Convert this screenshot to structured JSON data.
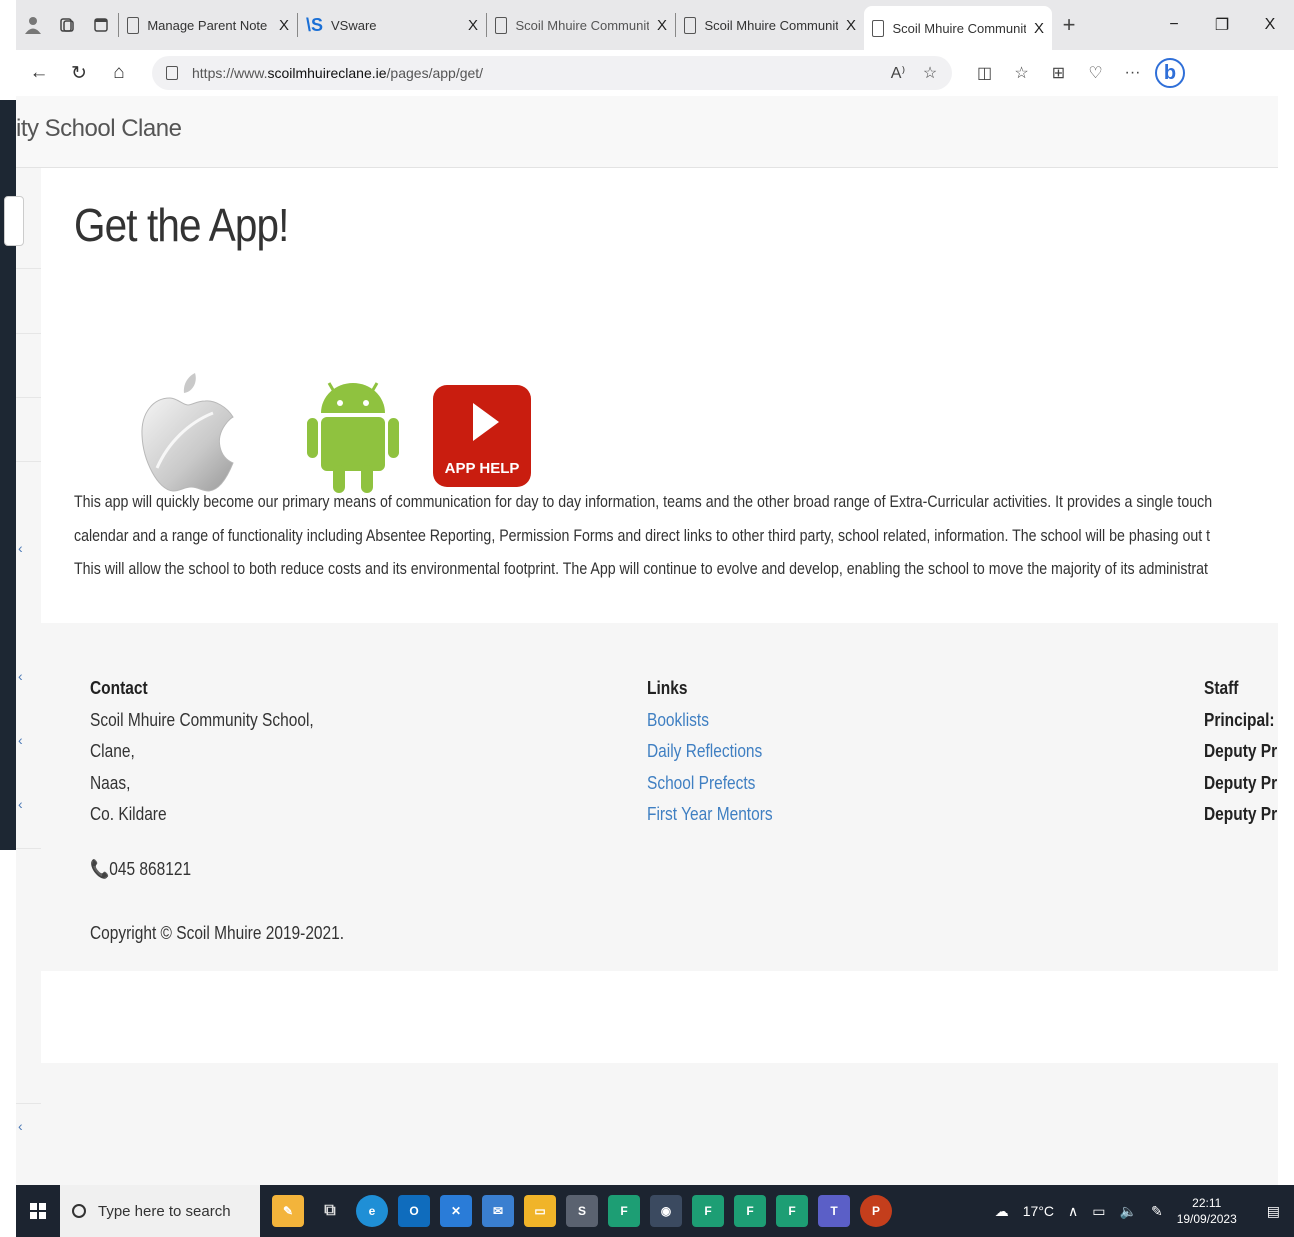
{
  "browser": {
    "tabs": [
      {
        "label": "Manage Parent Note List",
        "close": "X",
        "type": "doc"
      },
      {
        "label": "VSware",
        "close": "X",
        "type": "vsware"
      },
      {
        "label": "Scoil Mhuire Community S",
        "close": "X",
        "type": "doc"
      },
      {
        "label": "Scoil Mhuire Community S",
        "close": "X",
        "type": "doc"
      },
      {
        "label": "Scoil Mhuire Community S",
        "close": "X",
        "type": "doc",
        "active": true
      }
    ],
    "new_tab": "+",
    "window_controls": {
      "minimize": "−",
      "restore": "❐",
      "close": "X"
    },
    "url": {
      "scheme": "https://www.",
      "host": "scoilmhuireclane.ie",
      "path": "/pages/app/get/"
    }
  },
  "site": {
    "name": "ity School Clane"
  },
  "main": {
    "title": "Get the App!",
    "app_help_label": "APP HELP",
    "paragraph_lines": [
      "This app will quickly become our primary means of communication for day to day information, teams and the other broad range of Extra-Curricular activities. It provides a single touch",
      "calendar and a range of functionality including Absentee Reporting, Permission Forms and direct links to other third party, school related, information. The school will be phasing out t",
      "This will allow the school to both reduce costs and its environmental footprint. The App will continue to evolve and develop, enabling the school to move the majority of its administrat"
    ]
  },
  "footer": {
    "contact": {
      "heading": "Contact",
      "lines": [
        "Scoil Mhuire Community School,",
        "Clane,",
        "Naas,",
        "Co. Kildare"
      ],
      "phone": "045 868121"
    },
    "links": {
      "heading": "Links",
      "items": [
        "Booklists",
        "Daily Reflections",
        "School Prefects",
        "First Year Mentors"
      ]
    },
    "staff": {
      "heading": "Staff",
      "items": [
        "Principal:",
        "Deputy Pr",
        "Deputy Pr",
        "Deputy Pr"
      ]
    },
    "copyright": "Copyright © Scoil Mhuire 2019-2021."
  },
  "taskbar": {
    "search_placeholder": "Type here to search",
    "temperature": "17°C",
    "time": "22:11",
    "date": "19/09/2023"
  },
  "colors": {
    "link": "#3f7fc2",
    "app_help_red": "#c91d0f",
    "android_green": "#8fc23f",
    "taskbar": "#1c2430"
  }
}
